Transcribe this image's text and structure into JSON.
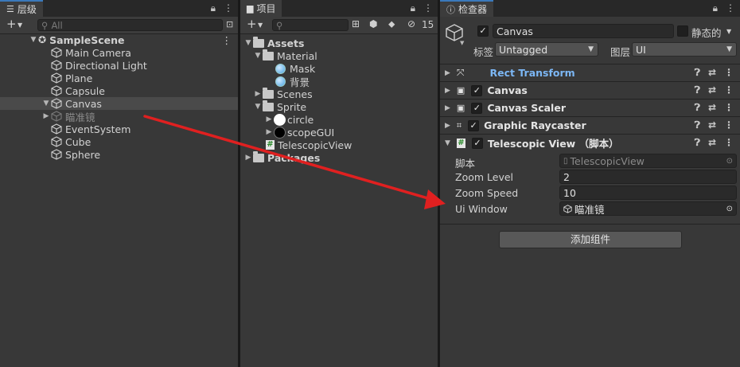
{
  "hierarchy": {
    "tab_label": "层级",
    "search_placeholder": "All",
    "scene_name": "SampleScene",
    "items": [
      {
        "label": "Main Camera"
      },
      {
        "label": "Directional Light"
      },
      {
        "label": "Plane"
      },
      {
        "label": "Capsule"
      },
      {
        "label": "Canvas"
      },
      {
        "label": "瞄准镜"
      },
      {
        "label": "EventSystem"
      },
      {
        "label": "Cube"
      },
      {
        "label": "Sphere"
      }
    ]
  },
  "project": {
    "tab_label": "项目",
    "visible_count": "15",
    "tree": [
      {
        "label": "Assets"
      },
      {
        "label": "Material"
      },
      {
        "label": "Mask"
      },
      {
        "label": "背景"
      },
      {
        "label": "Scenes"
      },
      {
        "label": "Sprite"
      },
      {
        "label": "circle"
      },
      {
        "label": "scopeGUI"
      },
      {
        "label": "TelescopicView"
      },
      {
        "label": "Packages"
      }
    ]
  },
  "inspector": {
    "tab_label": "检查器",
    "object_name": "Canvas",
    "static_label": "静态的",
    "tag_label": "标签",
    "tag_value": "Untagged",
    "layer_label": "图层",
    "layer_value": "UI",
    "components": [
      {
        "name": "Rect Transform"
      },
      {
        "name": "Canvas"
      },
      {
        "name": "Canvas Scaler"
      },
      {
        "name": "Graphic Raycaster"
      },
      {
        "name": "Telescopic View （脚本）"
      }
    ],
    "fields": {
      "script_label": "脚本",
      "script_value": "TelescopicView",
      "zoom_level_label": "Zoom Level",
      "zoom_level_value": "2",
      "zoom_speed_label": "Zoom Speed",
      "zoom_speed_value": "10",
      "ui_window_label": "Ui Window",
      "ui_window_value": "瞄准镜"
    },
    "add_component_label": "添加组件"
  },
  "colors": {
    "accent": "#3a79bb",
    "arrow": "#e02020",
    "rect_transform_text": "#7cb7f5"
  }
}
